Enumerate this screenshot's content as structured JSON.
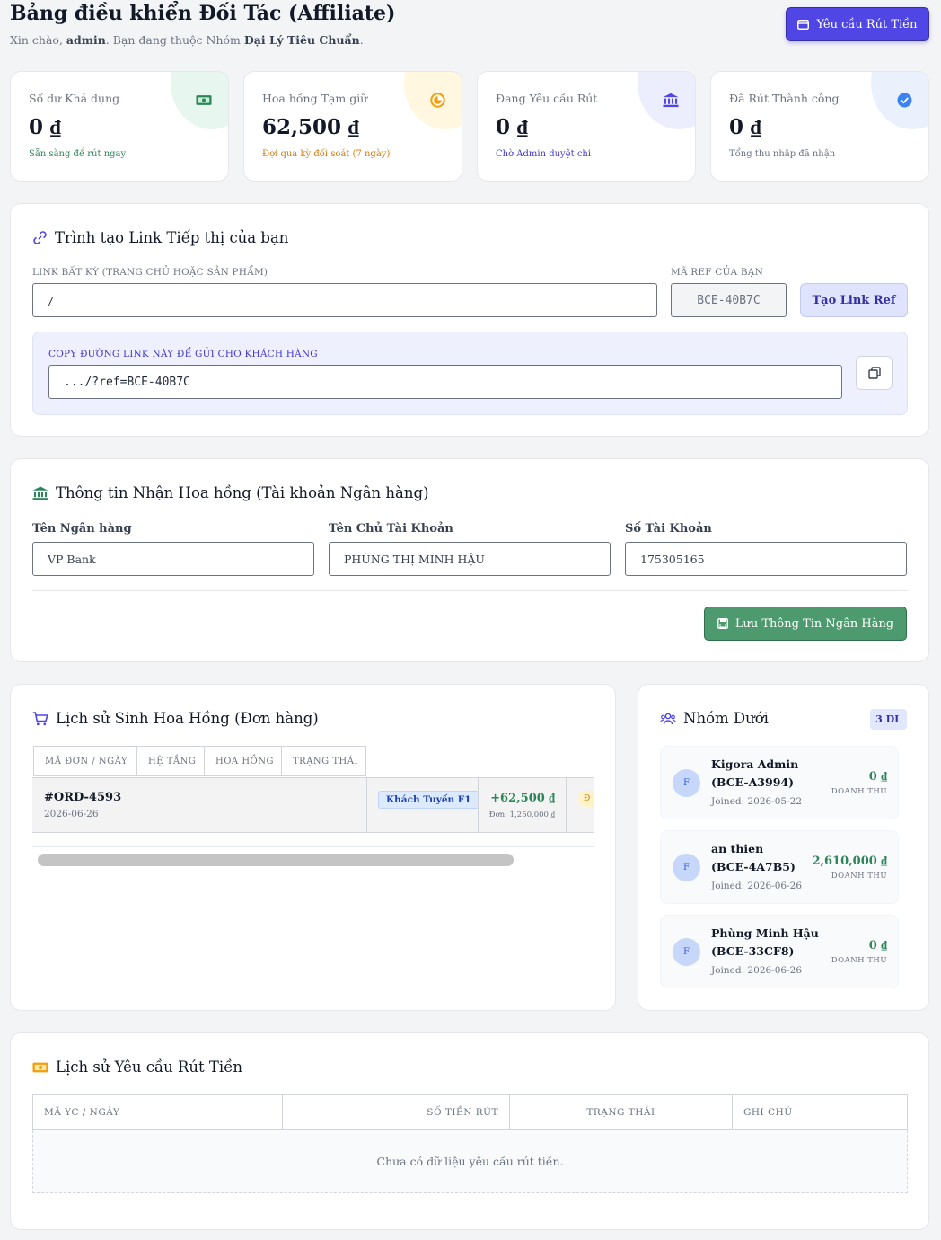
{
  "header": {
    "title": "Bảng điều khiển Đối Tác (Affiliate)",
    "greeting_prefix": "Xin chào, ",
    "user": "admin",
    "greeting_mid": ". Bạn đang thuộc Nhóm ",
    "group": "Đại Lý Tiêu Chuẩn",
    "greeting_end": ".",
    "withdraw_button": "Yêu cầu Rút Tiền"
  },
  "stats": [
    {
      "label": "Số dư Khả dụng",
      "value": "0 ₫",
      "note": "Sẵn sàng để rút ngay",
      "icon": "cash-icon",
      "accent": "#2f855a"
    },
    {
      "label": "Hoa hồng Tạm giữ",
      "value": "62,500 ₫",
      "note": "Đợi qua kỳ đối soát (7 ngày)",
      "icon": "clock-icon",
      "accent": "#d97706"
    },
    {
      "label": "Đang Yêu cầu Rút",
      "value": "0 ₫",
      "note": "Chờ Admin duyệt chi",
      "icon": "bank-icon",
      "accent": "#4338ca"
    },
    {
      "label": "Đã Rút Thành công",
      "value": "0 ₫",
      "note": "Tổng thu nhập đã nhận",
      "icon": "check-circle-icon",
      "accent": "#6b7280"
    }
  ],
  "link_builder": {
    "title": "Trình tạo Link Tiếp thị của bạn",
    "any_link_label": "LINK BẤT KỲ (TRANG CHỦ HOẶC SẢN PHẨM)",
    "any_link_value": "/",
    "ref_label": "MÃ REF CỦA BẠN",
    "ref_code": "BCE-40B7C",
    "create_button": "Tạo Link Ref",
    "copy_label": "COPY ĐƯỜNG LINK NÀY ĐỂ GỬI CHO KHÁCH HÀNG",
    "generated_link": ".../?ref=BCE-40B7C"
  },
  "bank": {
    "title": "Thông tin Nhận Hoa hồng (Tài khoản Ngân hàng)",
    "bank_name_label": "Tên Ngân hàng",
    "bank_name": "VP Bank",
    "holder_label": "Tên Chủ Tài Khoản",
    "holder": "PHÙNG THỊ MINH HẬU",
    "account_label": "Số Tài Khoản",
    "account": "175305165",
    "save_button": "Lưu Thông Tin Ngân Hàng"
  },
  "commission_history": {
    "title": "Lịch sử Sinh Hoa Hồng (Đơn hàng)",
    "columns": [
      "MÃ ĐƠN / NGÀY",
      "HỆ TẦNG",
      "HOA HỒNG",
      "TRẠNG THÁI"
    ],
    "rows": [
      {
        "order": "#ORD-4593",
        "date": "2026-06-26",
        "tier": "Khách Tuyến F1",
        "commission": "+62,500 ₫",
        "order_total": "Đơn: 1,250,000 ₫",
        "status": "Đ"
      }
    ]
  },
  "team": {
    "title": "Nhóm Dưới",
    "count_badge": "3 DL",
    "members": [
      {
        "initial": "F",
        "name": "Kigora Admin (BCE-A3994)",
        "joined": "Joined: 2026-05-22",
        "revenue": "0 ₫",
        "revenue_label": "DOANH THU"
      },
      {
        "initial": "F",
        "name": "an thien (BCE-4A7B5)",
        "joined": "Joined: 2026-06-26",
        "revenue": "2,610,000 ₫",
        "revenue_label": "DOANH THU"
      },
      {
        "initial": "F",
        "name": "Phùng Minh Hậu (BCE-33CF8)",
        "joined": "Joined: 2026-06-26",
        "revenue": "0 ₫",
        "revenue_label": "DOANH THU"
      }
    ]
  },
  "withdraw_history": {
    "title": "Lịch sử Yêu cầu Rút Tiền",
    "columns": [
      "MÃ YC / NGÀY",
      "SỐ TIỀN RÚT",
      "TRẠNG THÁI",
      "GHI CHÚ"
    ],
    "empty": "Chưa có dữ liệu yêu cầu rút tiền."
  }
}
